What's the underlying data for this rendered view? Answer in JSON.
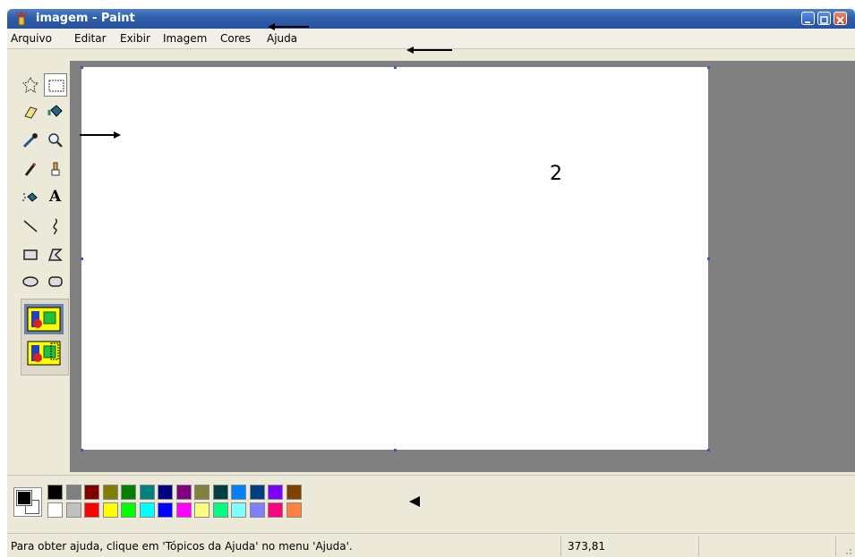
{
  "window": {
    "title": "imagem - Paint"
  },
  "menubar": {
    "items": [
      "Arquivo",
      "Editar",
      "Exibir",
      "Imagem",
      "Cores",
      "Ajuda"
    ]
  },
  "toolbox": {
    "tools": [
      {
        "name": "free-form-select-icon"
      },
      {
        "name": "rect-select-icon",
        "selected": true
      },
      {
        "name": "eraser-icon"
      },
      {
        "name": "fill-bucket-icon"
      },
      {
        "name": "color-picker-icon"
      },
      {
        "name": "magnifier-icon"
      },
      {
        "name": "pencil-icon"
      },
      {
        "name": "brush-icon"
      },
      {
        "name": "airbrush-icon"
      },
      {
        "name": "text-icon",
        "glyph": "A"
      },
      {
        "name": "line-icon"
      },
      {
        "name": "curve-icon"
      },
      {
        "name": "rectangle-icon"
      },
      {
        "name": "polygon-icon"
      },
      {
        "name": "ellipse-icon"
      },
      {
        "name": "rounded-rect-icon"
      }
    ],
    "options": [
      {
        "name": "opaque-background-option-icon",
        "selected": true
      },
      {
        "name": "transparent-background-option-icon",
        "selected": false
      }
    ]
  },
  "palette": {
    "foreground": "#000000",
    "background": "#ffffff",
    "row1": [
      "#000000",
      "#808080",
      "#800000",
      "#808000",
      "#008000",
      "#008080",
      "#000080",
      "#800080",
      "#808040",
      "#004040",
      "#0080ff",
      "#004080",
      "#8000ff",
      "#804000"
    ],
    "row2": [
      "#ffffff",
      "#c0c0c0",
      "#ff0000",
      "#ffff00",
      "#00ff00",
      "#00ffff",
      "#0000ff",
      "#ff00ff",
      "#ffff80",
      "#00ff80",
      "#80ffff",
      "#8080ff",
      "#ff0080",
      "#ff8040"
    ]
  },
  "statusbar": {
    "help_text": "Para obter ajuda, clique em 'Tópicos da Ajuda' no menu 'Ajuda'.",
    "coordinates": "373,81"
  },
  "annotation": {
    "label": "2"
  }
}
